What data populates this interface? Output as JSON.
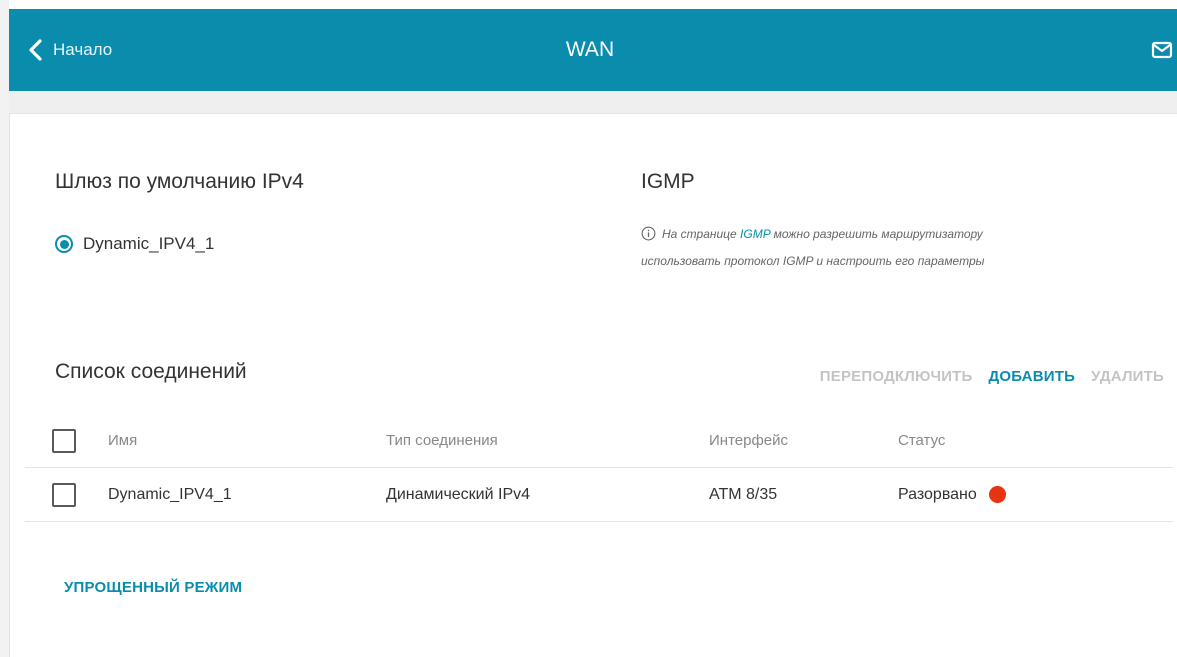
{
  "header": {
    "back_label": "Начало",
    "title": "WAN",
    "accent_color": "#0a8cad"
  },
  "gateway": {
    "heading": "Шлюз по умолчанию IPv4",
    "option": "Dynamic_IPV4_1",
    "selected": true
  },
  "igmp": {
    "heading": "IGMP",
    "info_before": "На странице ",
    "info_link": "IGMP",
    "info_after": " можно разрешить маршрутизатору",
    "info_line2": "использовать протокол IGMP и настроить его параметры"
  },
  "connections": {
    "heading": "Список соединений",
    "actions": {
      "reconnect": "ПЕРЕПОДКЛЮЧИТЬ",
      "add": "ДОБАВИТЬ",
      "delete": "УДАЛИТЬ"
    },
    "columns": [
      "Имя",
      "Тип соединения",
      "Интерфейс",
      "Статус"
    ],
    "rows": [
      {
        "name": "Dynamic_IPV4_1",
        "type": "Динамический IPv4",
        "interface": "ATM 8/35",
        "status": "Разорвано",
        "status_color": "#e63312"
      }
    ]
  },
  "footer": {
    "simple_mode": "УПРОЩЕННЫЙ РЕЖИМ"
  },
  "icons": {
    "back": "chevron-left-icon",
    "mail": "mail-icon",
    "info": "info-icon"
  }
}
